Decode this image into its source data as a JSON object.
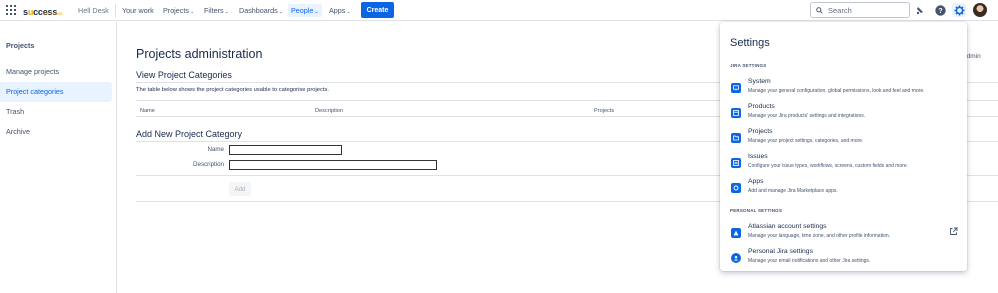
{
  "topbar": {
    "logo_text": "success",
    "logo_highlight": "o",
    "logo_sub": "SOFTWARE",
    "site_name": "Hell Desk",
    "nav": [
      {
        "label": "Your work",
        "dropdown": false
      },
      {
        "label": "Projects",
        "dropdown": true
      },
      {
        "label": "Filters",
        "dropdown": true
      },
      {
        "label": "Dashboards",
        "dropdown": true
      },
      {
        "label": "People",
        "dropdown": true,
        "active": true
      },
      {
        "label": "Apps",
        "dropdown": true
      }
    ],
    "create_label": "Create",
    "search_placeholder": "Search",
    "icons": [
      "notifications-icon",
      "help-icon",
      "settings-icon",
      "avatar"
    ]
  },
  "sidebar": {
    "title": "Projects",
    "items": [
      {
        "label": "Manage projects",
        "selected": false
      },
      {
        "label": "Project categories",
        "selected": true
      },
      {
        "label": "Trash",
        "selected": false
      },
      {
        "label": "Archive",
        "selected": false
      }
    ]
  },
  "main": {
    "page_title": "Projects administration",
    "view_title": "View Project Categories",
    "view_desc": "The table below shows the project categories usable to categorise projects.",
    "columns": [
      "Name",
      "Description",
      "Projects"
    ],
    "add_title": "Add New Project Category",
    "name_label": "Name",
    "description_label": "Description",
    "add_button": "Add",
    "partial_text": "admin"
  },
  "settings_menu": {
    "title": "Settings",
    "jira_section": "JIRA SETTINGS",
    "jira_items": [
      {
        "title": "System",
        "desc": "Manage your general configuration, global permissions, look and feel and more.",
        "icon": "system-icon"
      },
      {
        "title": "Products",
        "desc": "Manage your Jira products' settings and integrations.",
        "icon": "products-icon"
      },
      {
        "title": "Projects",
        "desc": "Manage your project settings, categories, and more.",
        "icon": "projects-icon"
      },
      {
        "title": "Issues",
        "desc": "Configure your issue types, workflows, screens, custom fields and more.",
        "icon": "issues-icon"
      },
      {
        "title": "Apps",
        "desc": "Add and manage Jira Marketplace apps.",
        "icon": "apps-icon"
      }
    ],
    "personal_section": "PERSONAL SETTINGS",
    "personal_items": [
      {
        "title": "Atlassian account settings",
        "desc": "Manage your language, time zone, and other profile information.",
        "icon": "atlassian-icon",
        "external": true
      },
      {
        "title": "Personal Jira settings",
        "desc": "Manage your email notifications and other Jira settings.",
        "icon": "personal-settings-icon",
        "external": false
      }
    ]
  },
  "colors": {
    "accent": "#0c66e4",
    "text": "#172b4d",
    "subtle": "#44546f",
    "border": "#dfe1e6",
    "logo_yellow": "#f4a000"
  }
}
